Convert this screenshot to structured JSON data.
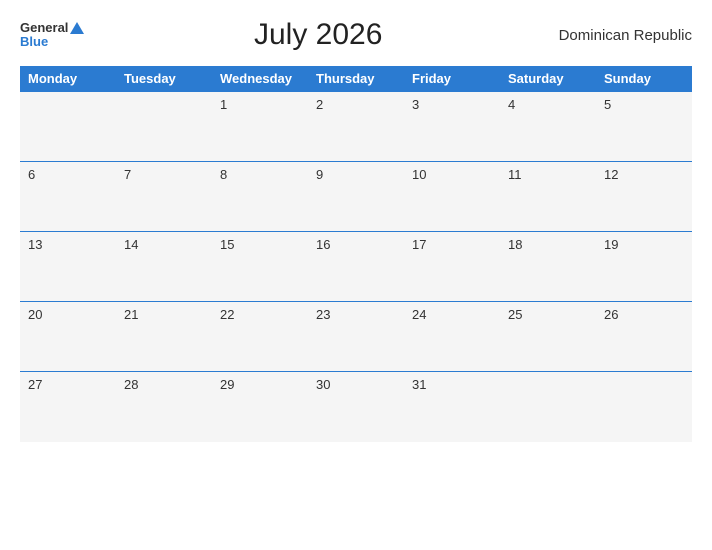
{
  "header": {
    "logo_general": "General",
    "logo_blue": "Blue",
    "title": "July 2026",
    "country": "Dominican Republic"
  },
  "days_of_week": [
    "Monday",
    "Tuesday",
    "Wednesday",
    "Thursday",
    "Friday",
    "Saturday",
    "Sunday"
  ],
  "weeks": [
    [
      "",
      "",
      "1",
      "2",
      "3",
      "4",
      "5"
    ],
    [
      "6",
      "7",
      "8",
      "9",
      "10",
      "11",
      "12"
    ],
    [
      "13",
      "14",
      "15",
      "16",
      "17",
      "18",
      "19"
    ],
    [
      "20",
      "21",
      "22",
      "23",
      "24",
      "25",
      "26"
    ],
    [
      "27",
      "28",
      "29",
      "30",
      "31",
      "",
      ""
    ]
  ],
  "colors": {
    "header_bg": "#2b7bd1",
    "logo_blue": "#2b7bd1"
  }
}
